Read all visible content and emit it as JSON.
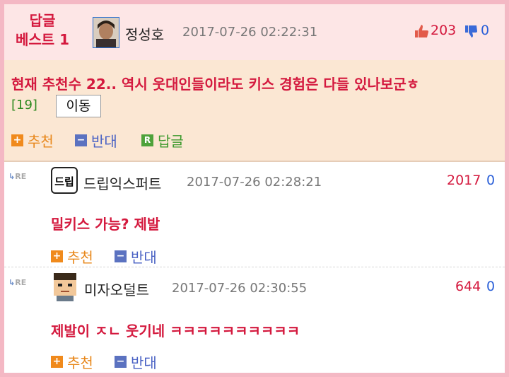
{
  "best": {
    "badge": "답글 베스트 1",
    "nickname": "정성호",
    "date": "2017-07-26 02:22:31",
    "up_count": "203",
    "down_count": "0",
    "content": "현재 추천수 22.. 역시 웃대인들이라도 키스 경험은 다들 있나보군ㅎ",
    "reply_count": "[19]",
    "move_label": "이동",
    "actions": {
      "up": "추천",
      "down": "반대",
      "reply": "답글"
    }
  },
  "replies": [
    {
      "re_label": "RE",
      "avatar_text": "드립",
      "nickname": "드립익스퍼트",
      "date": "2017-07-26 02:28:21",
      "up_count": "2017",
      "down_count": "0",
      "content": "밀키스 가능? 제발",
      "actions": {
        "up": "추천",
        "down": "반대"
      }
    },
    {
      "re_label": "RE",
      "nickname": "미자오덜트",
      "date": "2017-07-26 02:30:55",
      "up_count": "644",
      "down_count": "0",
      "content": "제발이 ㅈㄴ 웃기네 ㅋㅋㅋㅋㅋㅋㅋㅋㅋㅋ",
      "actions": {
        "up": "추천",
        "down": "반대"
      }
    }
  ],
  "colors": {
    "accent_red": "#d4193e",
    "up_orange": "#f08a1c",
    "down_blue": "#5b72c0",
    "reply_green": "#4ea23a",
    "frame_pink": "#f4b8c4"
  },
  "icons": {
    "up": "thumbs-up-icon",
    "down": "thumbs-down-icon",
    "re": "reply-arrow-icon"
  }
}
